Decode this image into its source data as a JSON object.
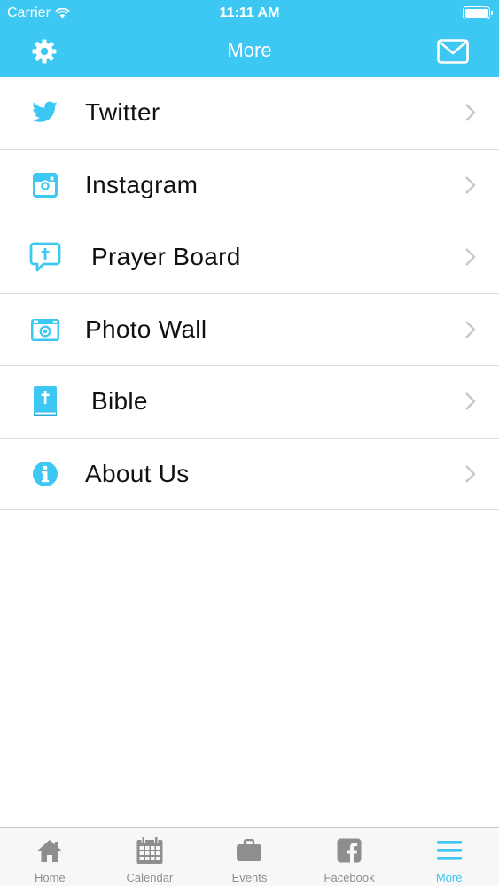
{
  "status_bar": {
    "carrier": "Carrier",
    "time": "11:11 AM"
  },
  "nav": {
    "title": "More",
    "left_icon": "gear-icon",
    "right_icon": "mail-icon"
  },
  "menu": [
    {
      "label": "Twitter",
      "icon": "twitter-icon"
    },
    {
      "label": "Instagram",
      "icon": "instagram-icon"
    },
    {
      "label": "Prayer Board",
      "icon": "prayer-board-icon"
    },
    {
      "label": "Photo Wall",
      "icon": "camera-icon"
    },
    {
      "label": "Bible",
      "icon": "bible-icon"
    },
    {
      "label": "About Us",
      "icon": "info-icon"
    }
  ],
  "tabs": [
    {
      "label": "Home",
      "icon": "home-icon"
    },
    {
      "label": "Calendar",
      "icon": "calendar-icon"
    },
    {
      "label": "Events",
      "icon": "briefcase-icon"
    },
    {
      "label": "Facebook",
      "icon": "facebook-icon"
    },
    {
      "label": "More",
      "icon": "menu-icon",
      "active": true
    }
  ],
  "colors": {
    "accent": "#3dc7f3",
    "tab_inactive": "#8e8e8e",
    "divider": "#dedede"
  }
}
